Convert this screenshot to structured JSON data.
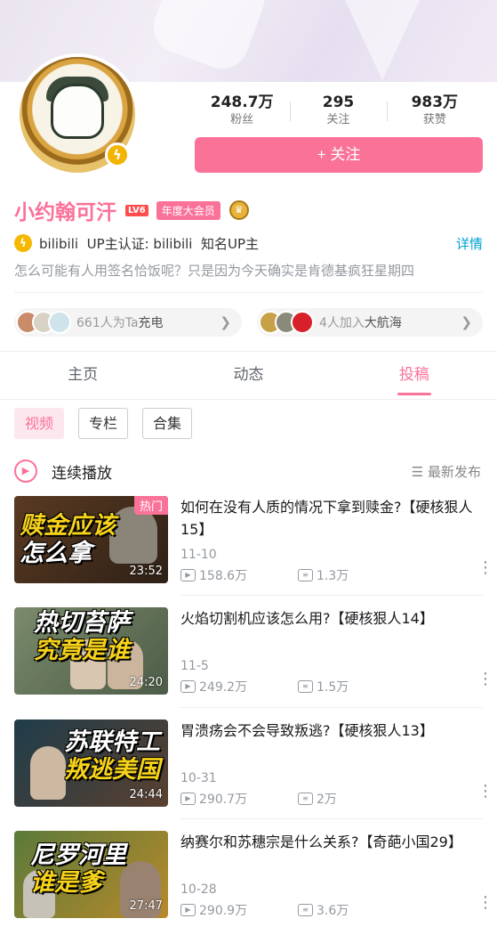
{
  "profile": {
    "name": "小约翰可汗",
    "level": "LV6",
    "vip_label": "年度大会员",
    "stats": [
      {
        "value": "248.7万",
        "label": "粉丝"
      },
      {
        "value": "295",
        "label": "关注"
      },
      {
        "value": "983万",
        "label": "获赞"
      }
    ],
    "follow_label": "+ 关注",
    "verify_text": "bilibili  UP主认证: bilibili  知名UP主",
    "detail_label": "详情",
    "signature": "怎么可能有人用签名恰饭呢？只是因为今天确实是肯德基疯狂星期四"
  },
  "pills": {
    "charge": {
      "count_text": "661人为Ta",
      "bold_text": "充电"
    },
    "crew": {
      "count_text": "4人加入",
      "bold_text": "大航海"
    }
  },
  "tabs": [
    {
      "label": "主页"
    },
    {
      "label": "动态"
    },
    {
      "label": "投稿"
    }
  ],
  "subtabs": [
    {
      "label": "视频"
    },
    {
      "label": "专栏"
    },
    {
      "label": "合集"
    }
  ],
  "playlist": {
    "play_label": "连续播放",
    "sort_label": "☰ 最新发布"
  },
  "videos": [
    {
      "title": "如何在没有人质的情况下拿到赎金?【硬核狠人15】",
      "date": "11-10",
      "views": "158.6万",
      "danmaku": "1.3万",
      "duration": "23:52",
      "badge": "热门",
      "thumb_line1": "赎金应该",
      "thumb_line2": "怎么拿"
    },
    {
      "title": "火焰切割机应该怎么用?【硬核狠人14】",
      "date": "11-5",
      "views": "249.2万",
      "danmaku": "1.5万",
      "duration": "24:20",
      "thumb_line1": "热切苔萨",
      "thumb_line2": "究竟是谁"
    },
    {
      "title": "胃溃疡会不会导致叛逃?【硬核狠人13】",
      "date": "10-31",
      "views": "290.7万",
      "danmaku": "2万",
      "duration": "24:44",
      "thumb_line1": "苏联特工",
      "thumb_line2": "叛逃美国"
    },
    {
      "title": "纳赛尔和苏穗宗是什么关系?【奇葩小国29】",
      "date": "10-28",
      "views": "290.9万",
      "danmaku": "3.6万",
      "duration": "27:47",
      "thumb_line1": "尼罗河里",
      "thumb_line2": "谁是爹"
    }
  ],
  "colors": {
    "accent": "#fb7299",
    "link": "#00a1d6"
  }
}
